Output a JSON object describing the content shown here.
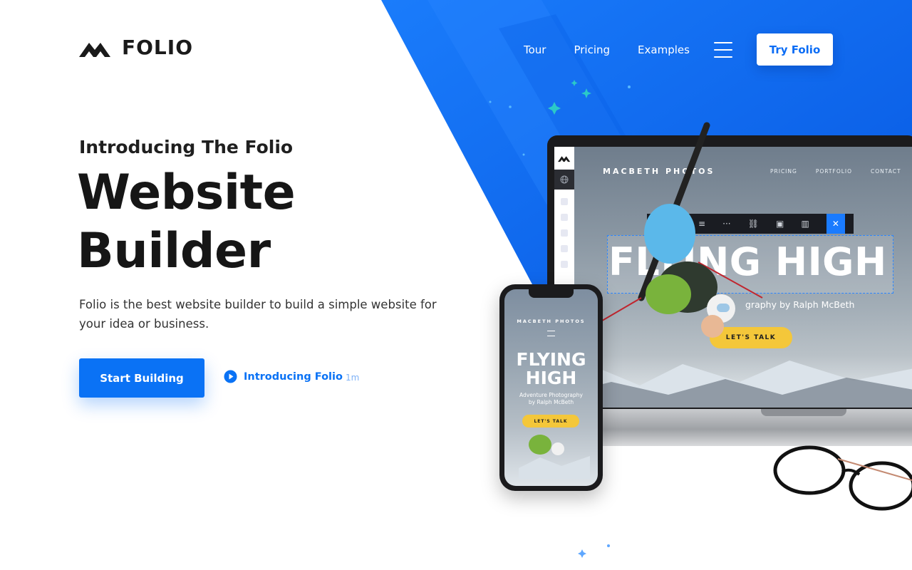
{
  "brand": {
    "name": "FOLIO"
  },
  "nav": {
    "items": [
      "Tour",
      "Pricing",
      "Examples"
    ],
    "cta": "Try Folio"
  },
  "hero": {
    "eyebrow": "Introducing The Folio",
    "headline": [
      "Website",
      "Builder"
    ],
    "lead": "Folio is the best website builder to build a simple website for your idea or business.",
    "primary_cta": "Start Building",
    "video_link": {
      "label": "Introducing Folio",
      "duration": "1m"
    }
  },
  "laptop_preview": {
    "brand": "MACBETH PHOTOS",
    "nav": [
      "PRICING",
      "PORTFOLIO",
      "CONTACT"
    ],
    "headline": "FLYING HIGH",
    "subtitle": "graphy by Ralph McBeth",
    "cta": "LET'S TALK",
    "toolbar_icons": [
      "bold-icon",
      "italic-icon",
      "align-icon",
      "more-icon",
      "link-icon",
      "image-icon",
      "trash-icon",
      "close-icon"
    ]
  },
  "phone_preview": {
    "brand": "MACBETH PHOTOS",
    "headline": [
      "FLYING",
      "HIGH"
    ],
    "subtitle": [
      "Adventure Photography",
      "by Ralph McBeth"
    ],
    "cta": "LET'S TALK"
  },
  "colors": {
    "primary": "#0a72f5",
    "background_blue": "#0b6cf2",
    "cta_yellow": "#f4c73a",
    "text_dark": "#161616"
  }
}
